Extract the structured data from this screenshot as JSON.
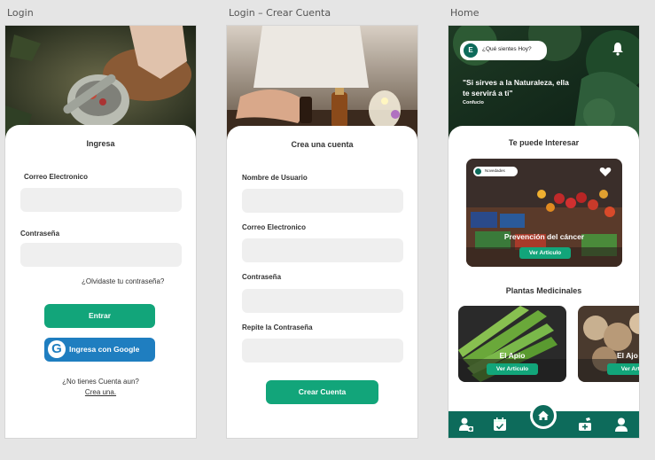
{
  "frames": {
    "login": {
      "label": "Login",
      "title": "Ingresa",
      "email_label": "Correo Electronico",
      "password_label": "Contraseña",
      "forgot": "¿Olvidaste tu contraseña?",
      "enter_button": "Entrar",
      "google_button": "Ingresa con Google",
      "google_letter": "G",
      "no_account": "¿No tienes Cuenta aun?",
      "create_link": "Crea una."
    },
    "register": {
      "label": "Login – Crear Cuenta",
      "title": "Crea una cuenta",
      "username_label": "Nombre de Usuario",
      "email_label": "Correo Electronico",
      "password_label": "Contraseña",
      "repeat_label": "Repite la Contraseña",
      "create_button": "Crear Cuenta"
    },
    "home": {
      "label": "Home",
      "avatar_letter": "E",
      "mood_prompt": "¿Qué sientes Hoy?",
      "quote": "\"Si sirves a la Naturaleza, ella te servirá a ti\"",
      "quote_author": "Confucio",
      "section1_title": "Te puede Interesar",
      "featured_tag": "Novedades",
      "featured_title": "Prevención del cáncer",
      "featured_button": "Ver Articulo",
      "section2_title": "Plantas Medicinales",
      "plants": [
        {
          "title": "El Apio",
          "button": "Ver Articulo"
        },
        {
          "title": "El Ajo",
          "button": "Ver Artic"
        }
      ],
      "nav": [
        "doctor-icon",
        "calendar-icon",
        "home-icon",
        "medkit-icon",
        "profile-icon"
      ]
    }
  },
  "colors": {
    "accent": "#12a57a",
    "google_blue": "#1f7ec0",
    "nav_bg": "#0d6b5b",
    "canvas": "#e5e5e5"
  }
}
